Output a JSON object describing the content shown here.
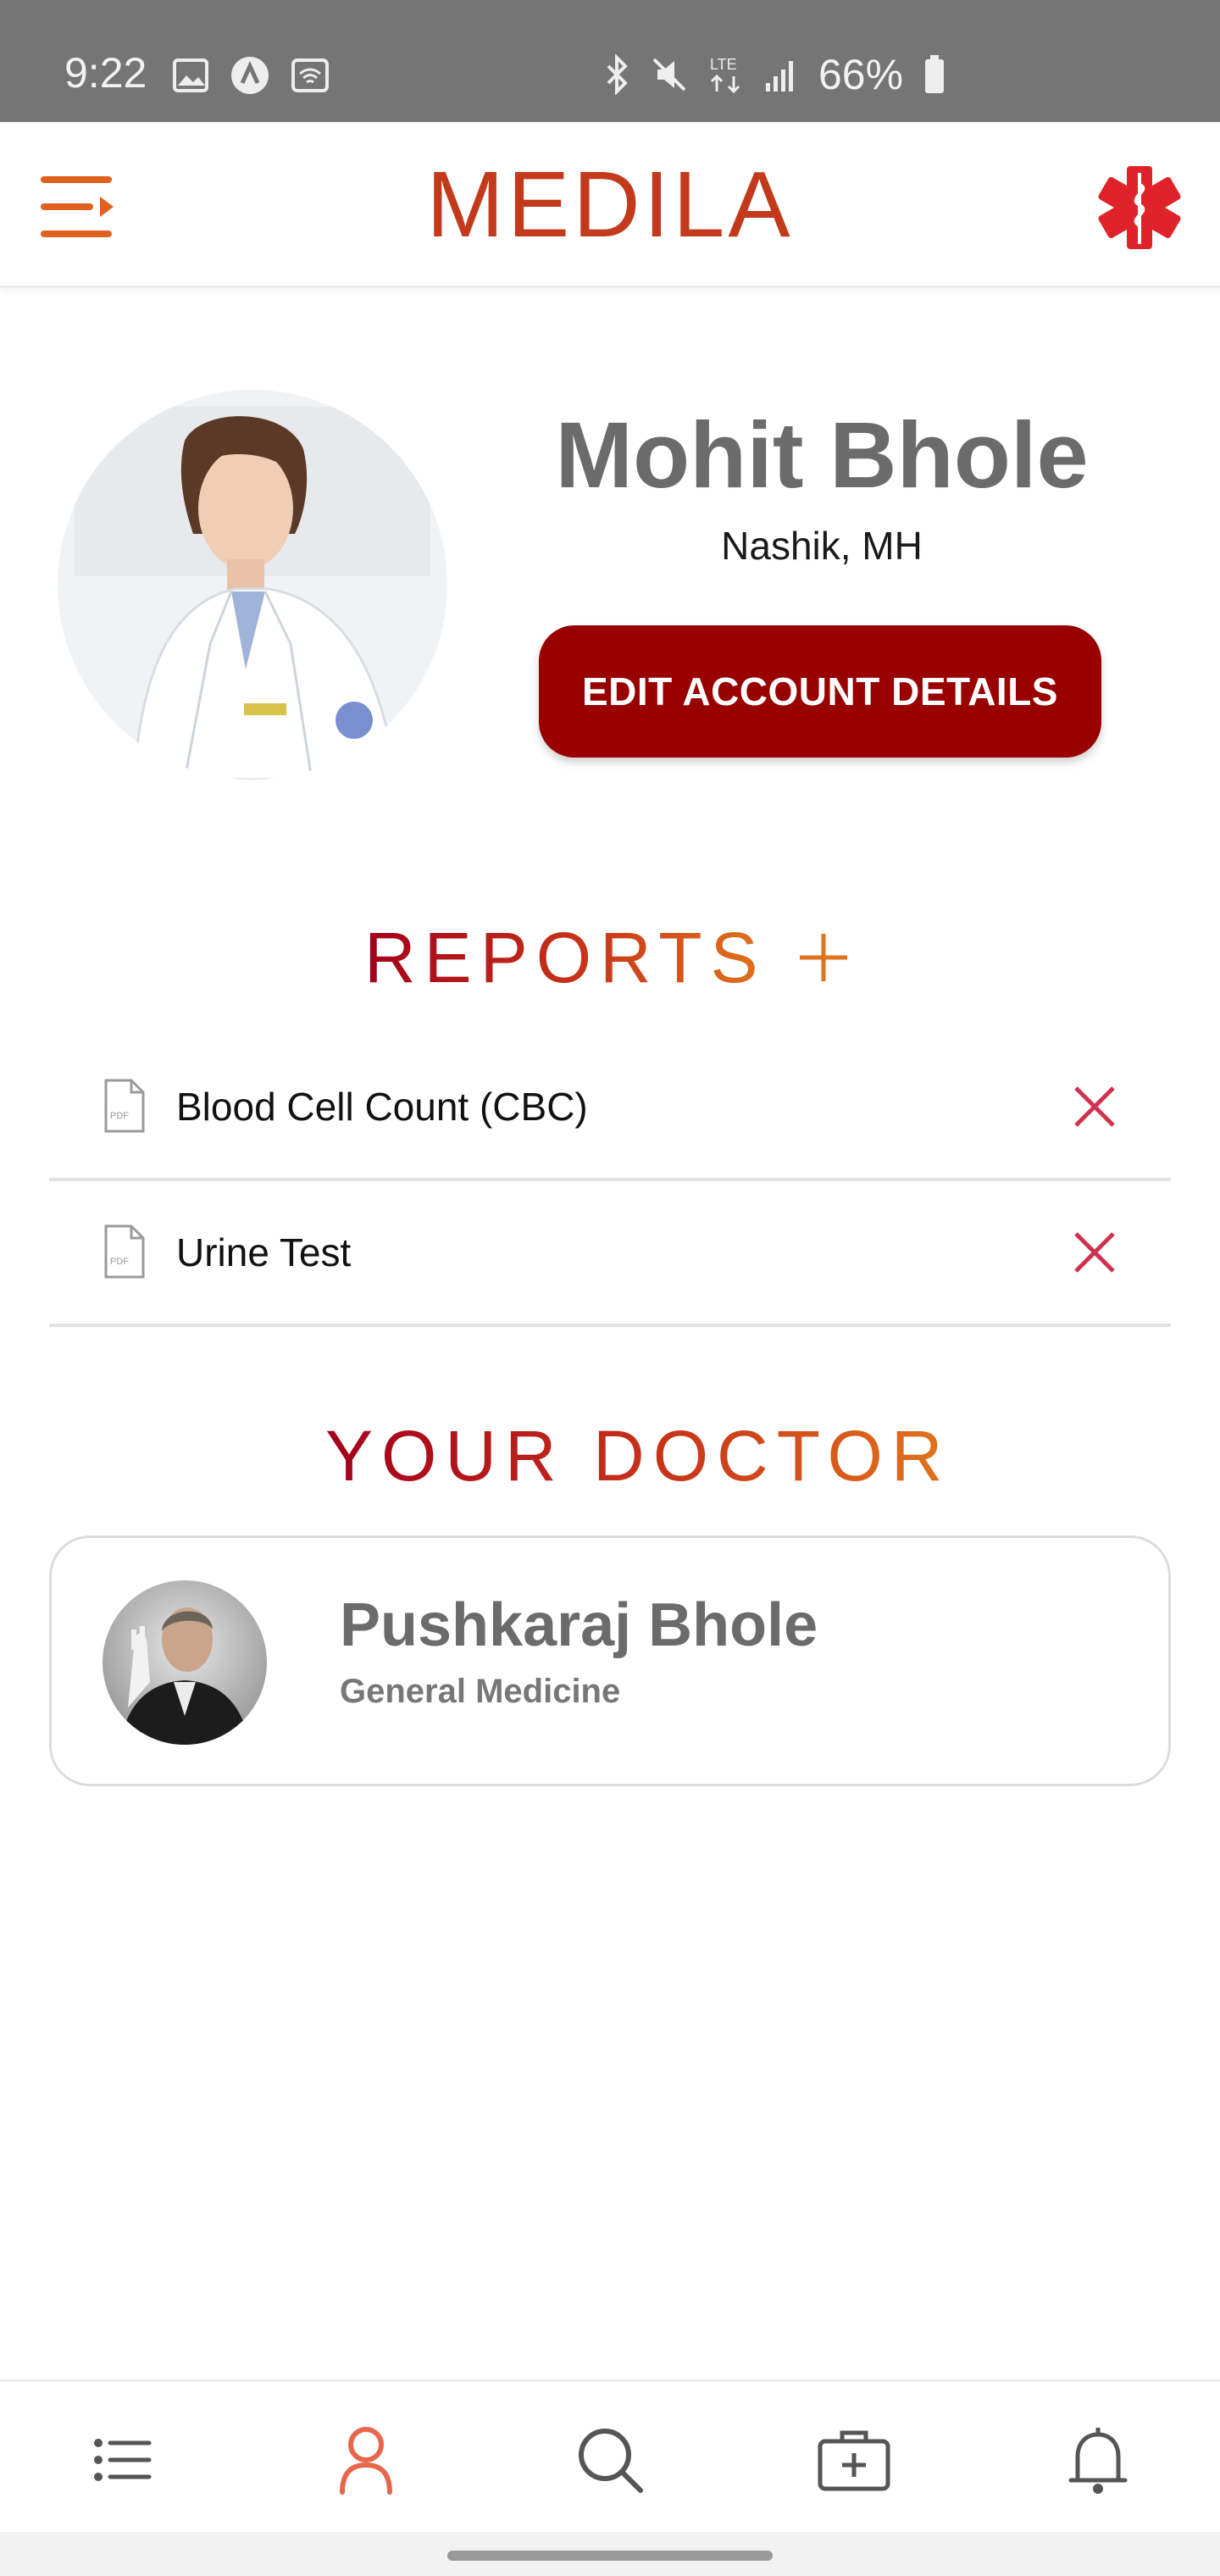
{
  "status_bar": {
    "time": "9:22",
    "battery": "66%",
    "icons": [
      "gallery-icon",
      "app-icon",
      "wifi-hotspot-icon",
      "bluetooth-icon",
      "mute-icon",
      "lte-icon",
      "signal-icon",
      "battery-icon"
    ]
  },
  "app_bar": {
    "brand": "MEDILA",
    "menu_icon": "menu-icon",
    "right_icon": "star-of-life-icon"
  },
  "profile": {
    "name": "Mohit Bhole",
    "location": "Nashik, MH",
    "edit_button": "EDIT ACCOUNT DETAILS"
  },
  "reports": {
    "title": "REPORTS",
    "items": [
      {
        "label": "Blood Cell Count (CBC)",
        "icon": "pdf-file-icon"
      },
      {
        "label": "Urine Test",
        "icon": "pdf-file-icon"
      }
    ]
  },
  "doctor": {
    "title": "YOUR DOCTOR",
    "name": "Pushkaraj Bhole",
    "specialty": "General Medicine"
  },
  "bottom_nav": {
    "items": [
      {
        "icon": "list-icon",
        "active": false
      },
      {
        "icon": "profile-icon",
        "active": true
      },
      {
        "icon": "search-icon",
        "active": false
      },
      {
        "icon": "medical-kit-icon",
        "active": false
      },
      {
        "icon": "bell-icon",
        "active": false
      }
    ]
  },
  "colors": {
    "accent": "#c23a1b",
    "button": "#990000",
    "delete": "#d0314f",
    "status_bar": "#757575",
    "nav_active": "#e8664a",
    "nav_inactive": "#555555"
  }
}
